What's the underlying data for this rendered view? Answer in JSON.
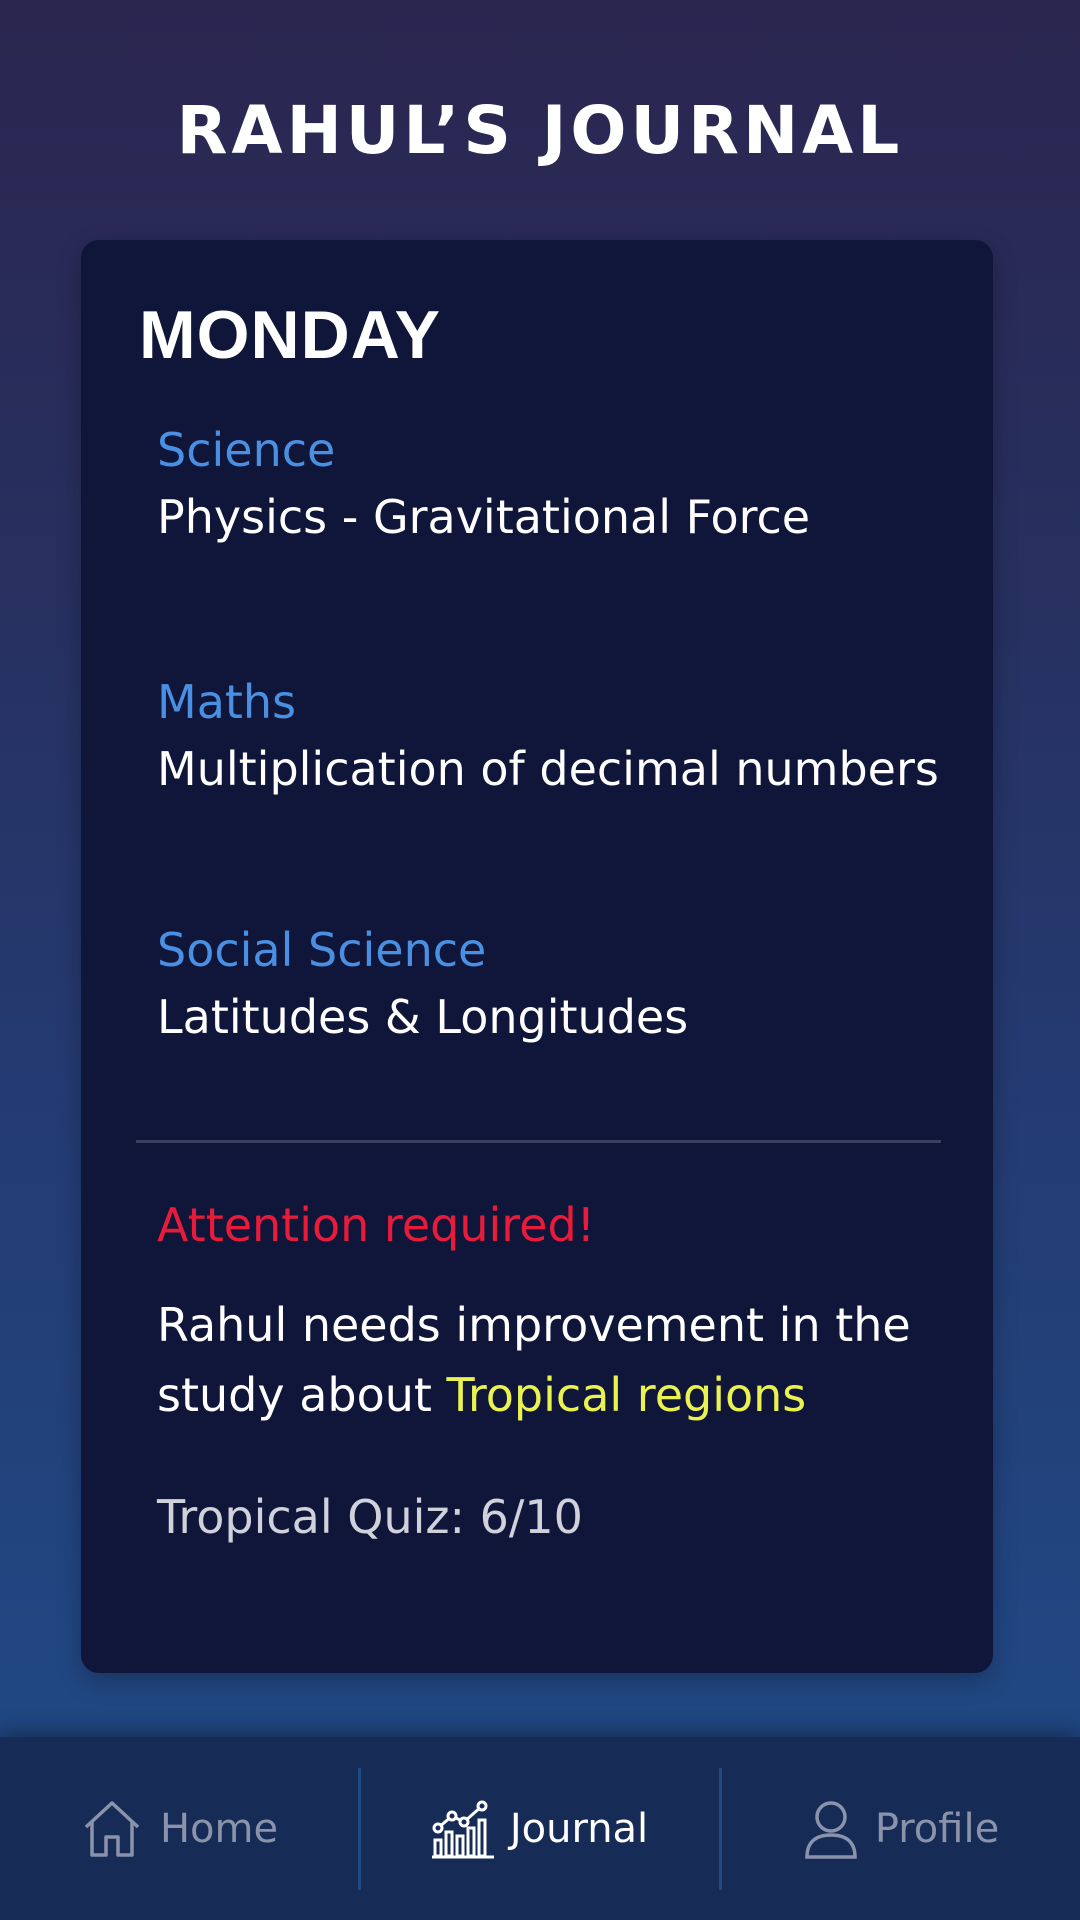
{
  "header": {
    "title": "RAHUL’S JOURNAL"
  },
  "card": {
    "day": "MONDAY",
    "subjects": [
      {
        "name": "Science",
        "topic": "Physics - Gravitational Force"
      },
      {
        "name": "Maths",
        "topic": "Multiplication of decimal numbers"
      },
      {
        "name": "Social Science",
        "topic": "Latitudes & Longitudes"
      }
    ],
    "alert": {
      "title": "Attention required!",
      "message_prefix": "Rahul needs improvement in the study about ",
      "highlight": "Tropical regions",
      "quiz": "Tropical Quiz: 6/10"
    }
  },
  "nav": {
    "items": [
      {
        "label": "Home",
        "icon": "home-icon"
      },
      {
        "label": "Journal",
        "icon": "chart-icon",
        "active": true
      },
      {
        "label": "Profile",
        "icon": "user-icon"
      }
    ]
  },
  "colors": {
    "subject": "#4a90e2",
    "alert": "#e81c3a",
    "highlight": "#e9f24f",
    "card": "#10153a"
  }
}
